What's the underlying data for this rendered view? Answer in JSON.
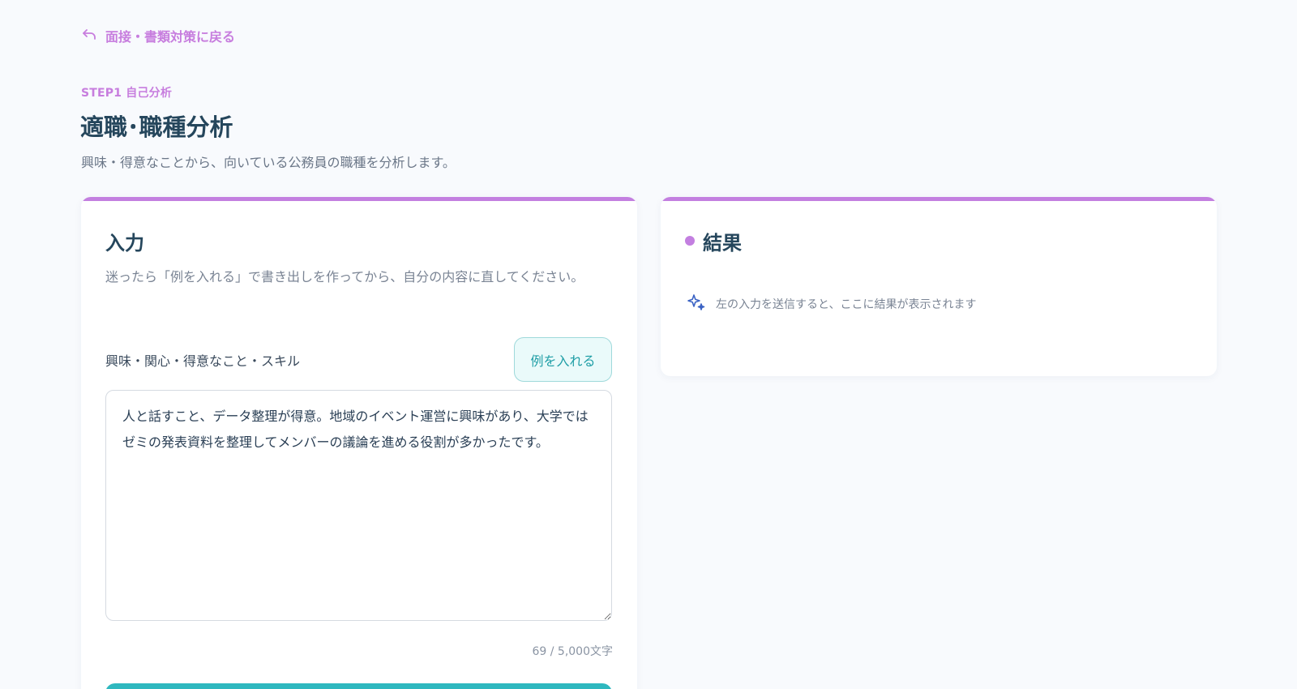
{
  "nav": {
    "back_label": "面接・書類対策に戻る",
    "back_icon": "undo-arrow-icon"
  },
  "header": {
    "step": "STEP1 自己分析",
    "title": "適職･職種分析",
    "subtitle": "興味・得意なことから、向いている公務員の職種を分析します。"
  },
  "input_card": {
    "title": "入力",
    "description": "迷ったら「例を入れる」で書き出しを作ってから、自分の内容に直してください。",
    "field_label": "興味・関心・得意なこと・スキル",
    "example_button": "例を入れる",
    "value": "人と話すこと、データ整理が得意。地域のイベント運営に興味があり、大学ではゼミの発表資料を整理してメンバーの議論を進める役割が多かったです。",
    "char_count": "69 / 5,000文字"
  },
  "result_card": {
    "title": "結果",
    "placeholder": "左の入力を送信すると、ここに結果が表示されます",
    "placeholder_icon": "sparkle-icon"
  },
  "colors": {
    "accent_purple": "#c37fe0",
    "accent_teal": "#2fb8bf",
    "title_navy": "#25465c",
    "background": "#f8fafd"
  }
}
